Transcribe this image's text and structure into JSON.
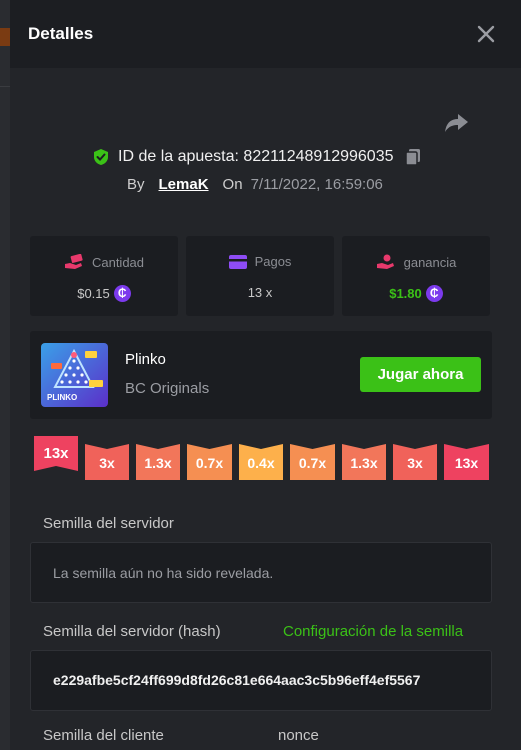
{
  "modal": {
    "title": "Detalles"
  },
  "bet": {
    "id_label": "ID de la apuesta: 82211248912996035",
    "by_label": "By",
    "user": "LemaK",
    "on_label": "On",
    "date": "7/11/2022, 16:59:06"
  },
  "stats": [
    {
      "label": "Cantidad",
      "value": "$0.15",
      "icon": "money-hand-icon",
      "color": "#e8396c"
    },
    {
      "label": "Pagos",
      "value": "13 x",
      "icon": "card-icon",
      "color": "#8e4cf5"
    },
    {
      "label": "ganancia",
      "value": "$1.80",
      "icon": "profit-hand-icon",
      "color": "#e8396c"
    }
  ],
  "coin_symbol": "₵",
  "game": {
    "name": "Plinko",
    "provider": "BC Originals",
    "play_label": "Jugar ahora",
    "thumb_text": "PLINKO"
  },
  "multipliers": [
    "13x",
    "3x",
    "1.3x",
    "0.7x",
    "0.4x",
    "0.7x",
    "1.3x",
    "3x",
    "13x"
  ],
  "seeds": {
    "server_label": "Semilla del servidor",
    "server_value": "La semilla aún no ha sido revelada.",
    "hash_label": "Semilla del servidor (hash)",
    "config_link": "Configuración de la semilla",
    "hash_value": "e229afbe5cf24ff699d8fd26c81e664aac3c5b96eff4ef5567",
    "client_label": "Semilla del cliente",
    "nonce_label": "nonce"
  },
  "colors": {
    "accent_green": "#3bc117",
    "coin_purple": "#7c3aed",
    "mult_high": "#ee4260",
    "mult_mid": "#f0625a",
    "mult_low": "#f58f52",
    "mult_center": "#fdb04b"
  }
}
